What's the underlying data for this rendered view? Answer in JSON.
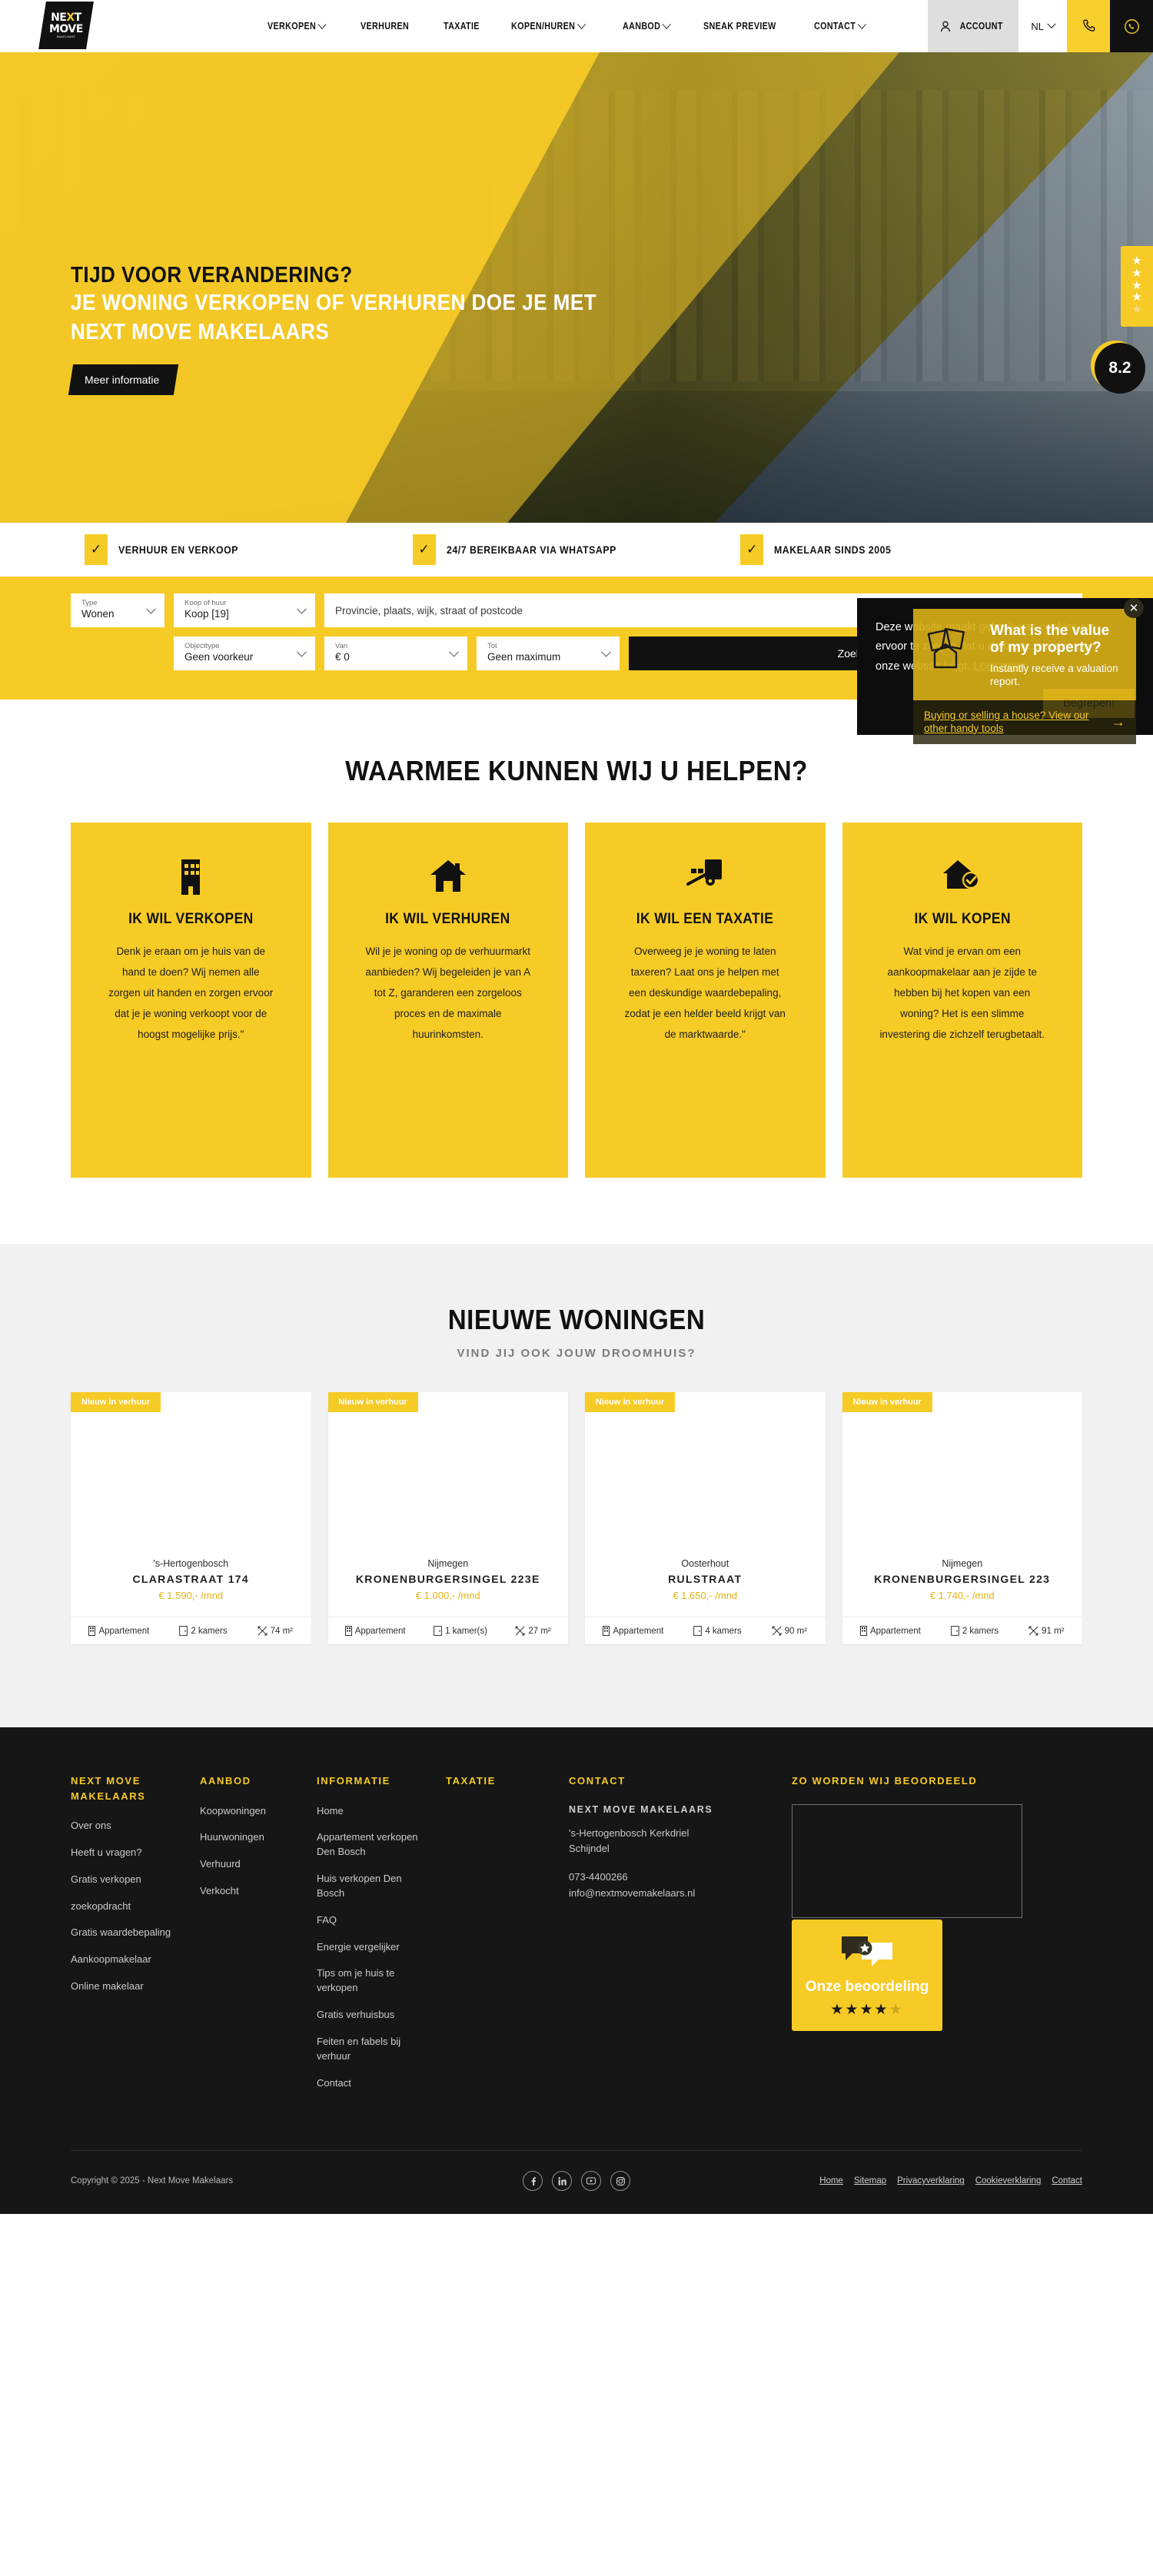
{
  "header": {
    "logo": {
      "line1_pre": "NE",
      "logo_text": "NEXT",
      "line2": "MOVE",
      "line3": "MAKELAARS"
    },
    "nav": [
      {
        "label": "VERKOPEN",
        "caret": true
      },
      {
        "label": "VERHUREN",
        "caret": false
      },
      {
        "label": "TAXATIE",
        "caret": false
      },
      {
        "label": "KOPEN/HUREN",
        "caret": true
      },
      {
        "label": "AANBOD",
        "caret": true
      },
      {
        "label": "SNEAK PREVIEW",
        "caret": false
      },
      {
        "label": "CONTACT",
        "caret": true
      }
    ],
    "account_label": "ACCOUNT",
    "language": "NL",
    "phone_icon": "phone-icon",
    "whatsapp_icon": "whatsapp-icon"
  },
  "hero": {
    "line1": "TIJD VOOR VERANDERING?",
    "line2": "JE WONING VERKOPEN OF VERHUREN DOE JE MET",
    "line3": "NEXT MOVE MAKELAARS",
    "button": "Meer informatie",
    "rating_score": "8.2",
    "stars_filled": 4,
    "stars_total": 5
  },
  "usps": [
    {
      "label": "VERHUUR EN VERKOOP",
      "check": "✓"
    },
    {
      "label": "24/7 BEREIKBAAR VIA WHATSAPP",
      "check": "✓"
    },
    {
      "label": "MAKELAAR SINDS 2005",
      "check": "✓"
    }
  ],
  "search": {
    "type": {
      "label": "Type",
      "value": "Wonen"
    },
    "koop": {
      "label": "Koop of huur",
      "value": "Koop [19]"
    },
    "location_placeholder": "Provincie, plaats, wijk, straat of postcode",
    "objecttype": {
      "label": "Objecttype",
      "value": "Geen voorkeur"
    },
    "van": {
      "label": "Van",
      "value": "€ 0"
    },
    "tot": {
      "label": "Tot",
      "value": "Geen maximum"
    },
    "submit": "Zoeken"
  },
  "cookie": {
    "text_1": "Deze website maakt gebruik van cookies om",
    "text_2": "ervoor te zorgen dat u de beste ervaring op",
    "text_3": "onze website krijgt.",
    "read_more": "Lees meer",
    "accept": "Begrepen!"
  },
  "promo": {
    "title": "What is the value of my property?",
    "subtitle": "Instantly receive a valuation report.",
    "link": "Buying or selling a house? View our other handy tools",
    "arrow": "→",
    "close": "✕"
  },
  "help": {
    "title": "WAARMEE KUNNEN WIJ U HELPEN?",
    "cards": [
      {
        "icon": "office-building-icon",
        "title": "IK WIL VERKOPEN",
        "body": "Denk je eraan om je huis van de hand te doen? Wij nemen alle zorgen uit handen en zorgen ervoor dat je je woning verkoopt voor de hoogst mogelijke prijs.\""
      },
      {
        "icon": "house-icon",
        "title": "IK WIL VERHUREN",
        "body": "Wil je je woning op de verhuurmarkt aanbieden? Wij begeleiden je van A tot Z, garanderen een zorgeloos proces en de maximale huurinkomsten."
      },
      {
        "icon": "hand-truck-icon",
        "title": "IK WIL EEN TAXATIE",
        "body": "Overweeg je je woning te laten taxeren? Laat ons je helpen met een deskundige waardebepaling, zodat je een helder beeld krijgt van de marktwaarde.\""
      },
      {
        "icon": "house-check-icon",
        "title": "IK WIL KOPEN",
        "body": "Wat vind je ervan om een aankoopmakelaar aan je zijde te hebben bij het kopen van een woning? Het is een slimme investering die zichzelf terugbetaalt."
      }
    ]
  },
  "homes": {
    "title": "NIEUWE WONINGEN",
    "subtitle": "VIND JIJ OOK JOUW DROOMHUIS?",
    "properties": [
      {
        "badge": "Nieuw in verhuur",
        "city": "'s-Hertogenbosch",
        "address": "CLARASTRAAT 174",
        "price": "€ 1.590,- /mnd",
        "type": "Appartement",
        "rooms": "2 kamers",
        "area": "74 m²"
      },
      {
        "badge": "Nieuw in verhuur",
        "city": "Nijmegen",
        "address": "KRONENBURGERSINGEL 223E",
        "price": "€ 1.000,- /mnd",
        "type": "Appartement",
        "rooms": "1 kamer(s)",
        "area": "27 m²"
      },
      {
        "badge": "Nieuw in verhuur",
        "city": "Oosterhout",
        "address": "RULSTRAAT",
        "price": "€ 1.650,- /mnd",
        "type": "Appartement",
        "rooms": "4 kamers",
        "area": "90 m²"
      },
      {
        "badge": "Nieuw in verhuur",
        "city": "Nijmegen",
        "address": "KRONENBURGERSINGEL 223",
        "price": "€ 1.740,- /mnd",
        "type": "Appartement",
        "rooms": "2 kamers",
        "area": "91 m²"
      }
    ]
  },
  "footer": {
    "col1": {
      "heading": "NEXT MOVE MAKELAARS",
      "links": [
        "Over ons",
        "Heeft u vragen?",
        "Gratis verkopen",
        "zoekopdracht",
        "Gratis waardebepaling",
        "Aankoopmakelaar",
        "Online makelaar"
      ]
    },
    "col2": {
      "heading": "AANBOD",
      "links": [
        "Koopwoningen",
        "Huurwoningen",
        "Verhuurd",
        "Verkocht"
      ]
    },
    "col3": {
      "heading": "INFORMATIE",
      "links": [
        "Home",
        "Appartement verkopen Den Bosch",
        "Huis verkopen Den Bosch",
        "FAQ",
        "Energie vergelijker",
        "Tips om je huis te verkopen",
        "Gratis verhuisbus",
        "Feiten en fabels bij verhuur",
        "Contact"
      ]
    },
    "col4": {
      "heading": "TAXATIE",
      "links": []
    },
    "col5": {
      "heading": "CONTACT",
      "company": "NEXT MOVE MAKELAARS",
      "address_1": "'s-Hertogenbosch Kerkdriel",
      "address_2": "Schijndel",
      "phone": "073-4400266",
      "email": "info@nextmovemakelaars.nl"
    },
    "col6": {
      "heading": "ZO WORDEN WIJ BEOORDEELD",
      "badge_title": "Onze beoordeling",
      "badge_stars_filled": 4,
      "badge_stars_total": 5
    },
    "copyright": "Copyright © 2025 - Next Move Makelaars",
    "social": [
      "facebook-icon",
      "linkedin-icon",
      "youtube-icon",
      "instagram-icon"
    ],
    "legal": [
      "Home",
      "Sitemap",
      "Privacyverklaring",
      "Cookieverklaring",
      "Contact"
    ]
  },
  "colors": {
    "brand_yellow": "#f7cb26",
    "dark": "#161616",
    "price_gold": "#e3b416"
  }
}
